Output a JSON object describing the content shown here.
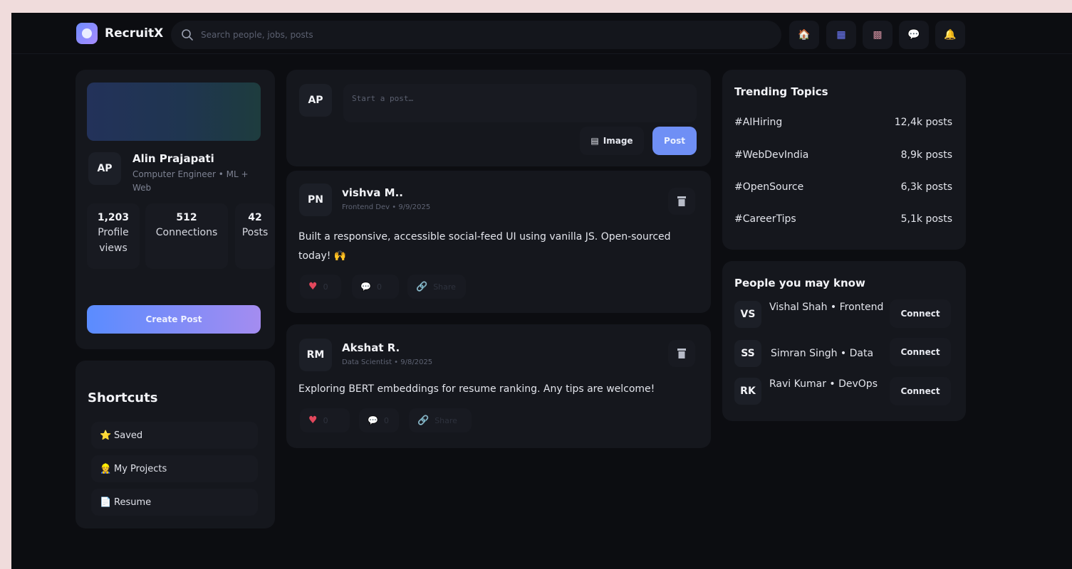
{
  "app": {
    "name": "RecruitX"
  },
  "search": {
    "placeholder": "Search people, jobs, posts"
  },
  "nav": [
    {
      "name": "home-icon",
      "glyph": "🏠"
    },
    {
      "name": "grid-icon",
      "glyph": "▦"
    },
    {
      "name": "flag-icon",
      "glyph": "▩"
    },
    {
      "name": "chat-icon",
      "glyph": "💬"
    },
    {
      "name": "bell-icon",
      "glyph": "🔔"
    }
  ],
  "profile": {
    "initials": "AP",
    "name": "Alin Prajapati",
    "title": "Computer Engineer • ML + Web",
    "stats": [
      {
        "value": "1,203",
        "label": "Profile views"
      },
      {
        "value": "512",
        "label": "Connections"
      },
      {
        "value": "42",
        "label": "Posts"
      }
    ],
    "create_post": "Create Post"
  },
  "shortcuts": {
    "title": "Shortcuts",
    "items": [
      {
        "icon": "⭐",
        "icon_name": "star-icon",
        "label": "Saved"
      },
      {
        "icon": "👷",
        "icon_name": "worker-icon",
        "label": "My Projects"
      },
      {
        "icon": "📄",
        "icon_name": "document-icon",
        "label": "Resume"
      }
    ]
  },
  "composer": {
    "initials": "AP",
    "placeholder": "Start a post…",
    "image_label": "Image",
    "post_label": "Post"
  },
  "posts": [
    {
      "initials": "PN",
      "author": "vishva M..",
      "meta": "Frontend Dev • 9/9/2025",
      "text": "Built a responsive, accessible social-feed UI using vanilla JS. Open-sourced today! 🙌",
      "likes": "0",
      "comments": "0",
      "share": "Share"
    },
    {
      "initials": "RM",
      "author": "Akshat R.",
      "meta": "Data Scientist • 9/8/2025",
      "text": "Exploring BERT embeddings for resume ranking. Any tips are welcome!",
      "likes": "0",
      "comments": "0",
      "share": "Share"
    }
  ],
  "trending": {
    "title": "Trending Topics",
    "topics": [
      {
        "tag": "#AIHiring",
        "count": "12,4k posts"
      },
      {
        "tag": "#WebDevIndia",
        "count": "8,9k posts"
      },
      {
        "tag": "#OpenSource",
        "count": "6,3k posts"
      },
      {
        "tag": "#CareerTips",
        "count": "5,1k posts"
      }
    ]
  },
  "people": {
    "title": "People you may know",
    "connect_label": "Connect",
    "items": [
      {
        "initials": "VS",
        "name": "Vishal Shah • Frontend"
      },
      {
        "initials": "SS",
        "name": "Simran Singh • Data"
      },
      {
        "initials": "RK",
        "name": "Ravi Kumar • DevOps"
      }
    ]
  },
  "colors": {
    "accent": "#6f8ff5",
    "background": "#0c0d11",
    "card": "#15171d",
    "like": "#e2475c"
  }
}
